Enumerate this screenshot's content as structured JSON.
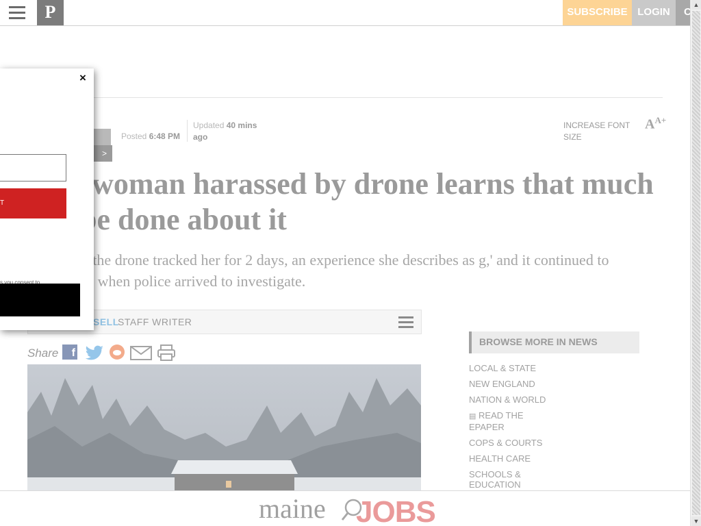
{
  "header": {
    "logo": "P",
    "subscribe_label": "SUBSCRIBE",
    "login_label": "LOGIN",
    "extra_label": "C"
  },
  "meta": {
    "tag_arrow": ">",
    "posted_label": "Posted",
    "posted_time": "6:48 PM",
    "updated_label": "Updated",
    "updated_time": "40 mins",
    "updated_suffix": "ago",
    "font_size_label": "INCREASE FONT SIZE",
    "font_size_icon_main": "A",
    "font_size_icon_sup": "A+"
  },
  "article": {
    "headline": "ham woman harassed by drone learns that much can be done about it",
    "subhead": "nham said the drone tracked her for 2 days, an experience she describes as g,' and it continued to hover even when police arrived to investigate."
  },
  "byline": {
    "name_fragment": "SELL",
    "role": "STAFF WRITER"
  },
  "share": {
    "label": "Share",
    "facebook_glyph": "f"
  },
  "sidebar": {
    "heading": "BROWSE MORE IN NEWS",
    "items": [
      "LOCAL & STATE",
      "NEW ENGLAND",
      "NATION & WORLD",
      "READ THE EPAPER",
      "COPS & COURTS",
      "HEALTH CARE",
      "SCHOOLS & EDUCATION"
    ]
  },
  "banner": {
    "maine": "maine",
    "jobs": "JOBS"
  },
  "modal": {
    "close_glyph": "×",
    "submit_fragment": "T",
    "consent_fragment": "s you consent to"
  },
  "scrollbar": {
    "up": "▲",
    "down": "▼"
  }
}
